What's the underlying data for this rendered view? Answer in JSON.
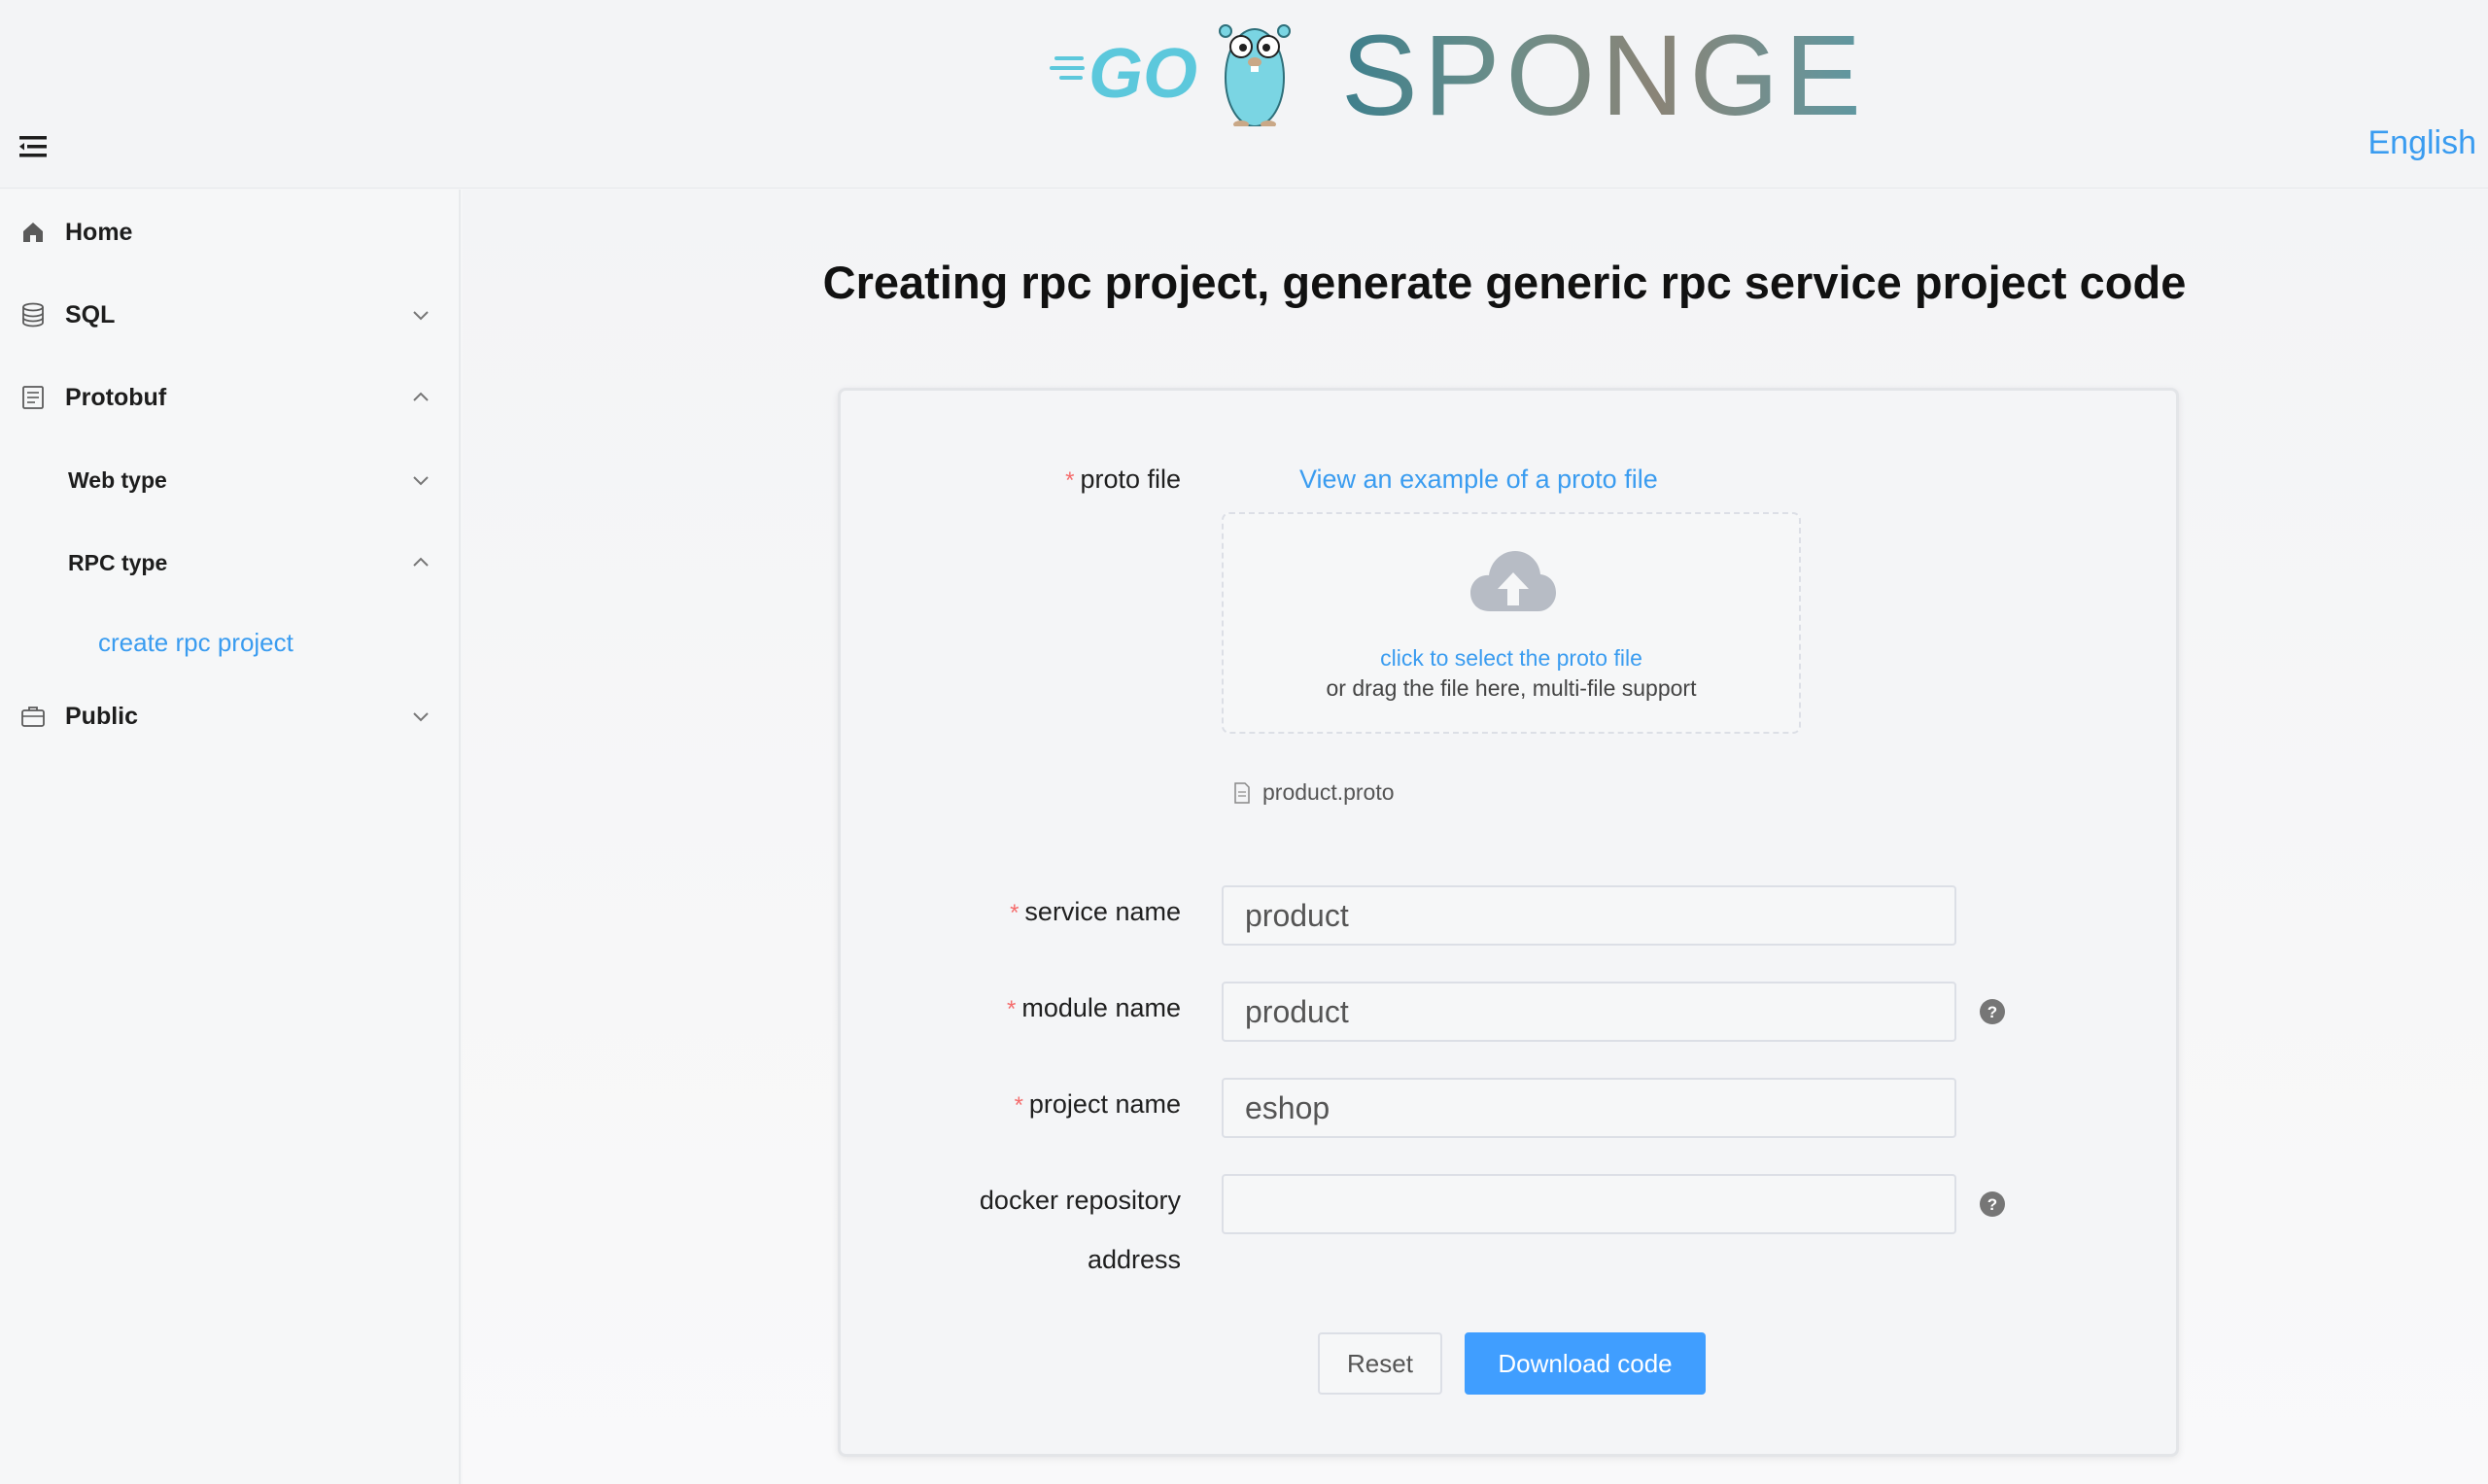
{
  "header": {
    "logo_text": "SPONGE",
    "logo_go_text": "GO",
    "language": "English"
  },
  "sidebar": {
    "items": [
      {
        "label": "Home",
        "icon": "home-icon"
      },
      {
        "label": "SQL",
        "icon": "database-icon",
        "expanded": false
      },
      {
        "label": "Protobuf",
        "icon": "document-icon",
        "expanded": true
      },
      {
        "label": "Web type",
        "expanded": false
      },
      {
        "label": "RPC type",
        "expanded": true
      },
      {
        "label": "create rpc project",
        "active": true
      },
      {
        "label": "Public",
        "icon": "briefcase-icon",
        "expanded": false
      }
    ]
  },
  "main": {
    "title": "Creating rpc project, generate generic rpc service project code"
  },
  "form": {
    "proto_file_label": "proto file",
    "example_link": "View an example of a proto file",
    "upload_link": "click to select the proto file",
    "upload_hint": "or drag the file here, multi-file support",
    "uploaded_file": "product.proto",
    "service_name_label": "service name",
    "service_name_value": "product",
    "module_name_label": "module name",
    "module_name_value": "product",
    "project_name_label": "project name",
    "project_name_value": "eshop",
    "docker_label_line1": "docker repository",
    "docker_label_line2": "address",
    "docker_value": "",
    "reset_label": "Reset",
    "download_label": "Download code"
  },
  "colors": {
    "accent": "#409eff",
    "link": "#3a9cf0",
    "required": "#f56c6c"
  }
}
